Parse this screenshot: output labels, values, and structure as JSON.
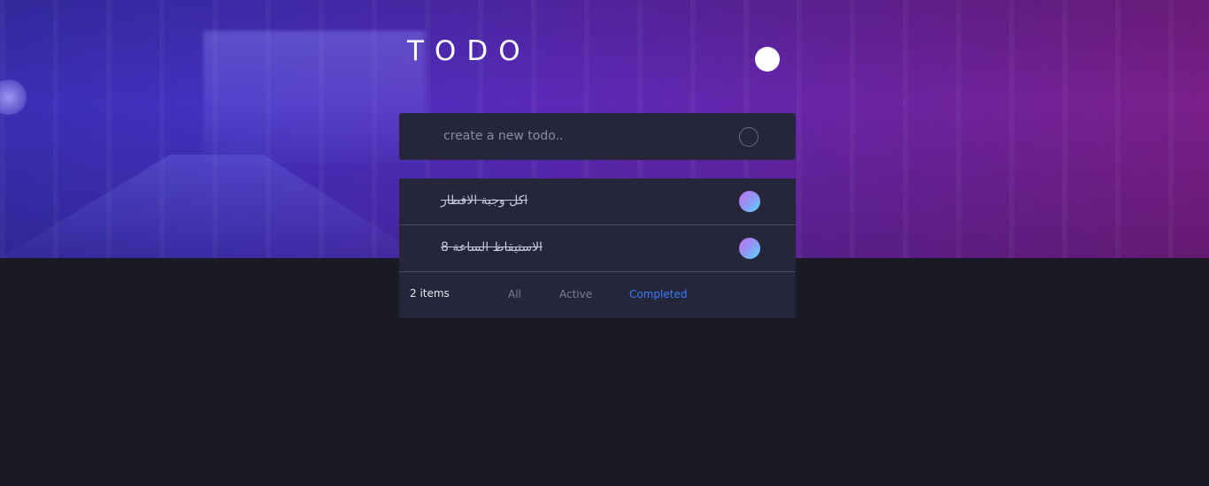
{
  "app": {
    "title": "TODO"
  },
  "new_todo": {
    "placeholder": "create a new todo.."
  },
  "todos": [
    {
      "text": "اكل وجبة الافطار",
      "completed": true
    },
    {
      "text": "الاستيقاظ الساعة 8",
      "completed": true
    }
  ],
  "footer": {
    "count_label": "2 items",
    "filters": [
      "All",
      "Active",
      "Completed"
    ],
    "selected_filter": "Completed"
  },
  "colors": {
    "accent": "#3a7bfd",
    "card_bg": "#25263a",
    "page_bg": "#1a1a26",
    "check_gradient_start": "#c26ef3",
    "check_gradient_end": "#57ddff"
  },
  "icons": {
    "theme_toggle": "sun-icon",
    "add": "circle-icon",
    "check": "check-circle-icon"
  }
}
